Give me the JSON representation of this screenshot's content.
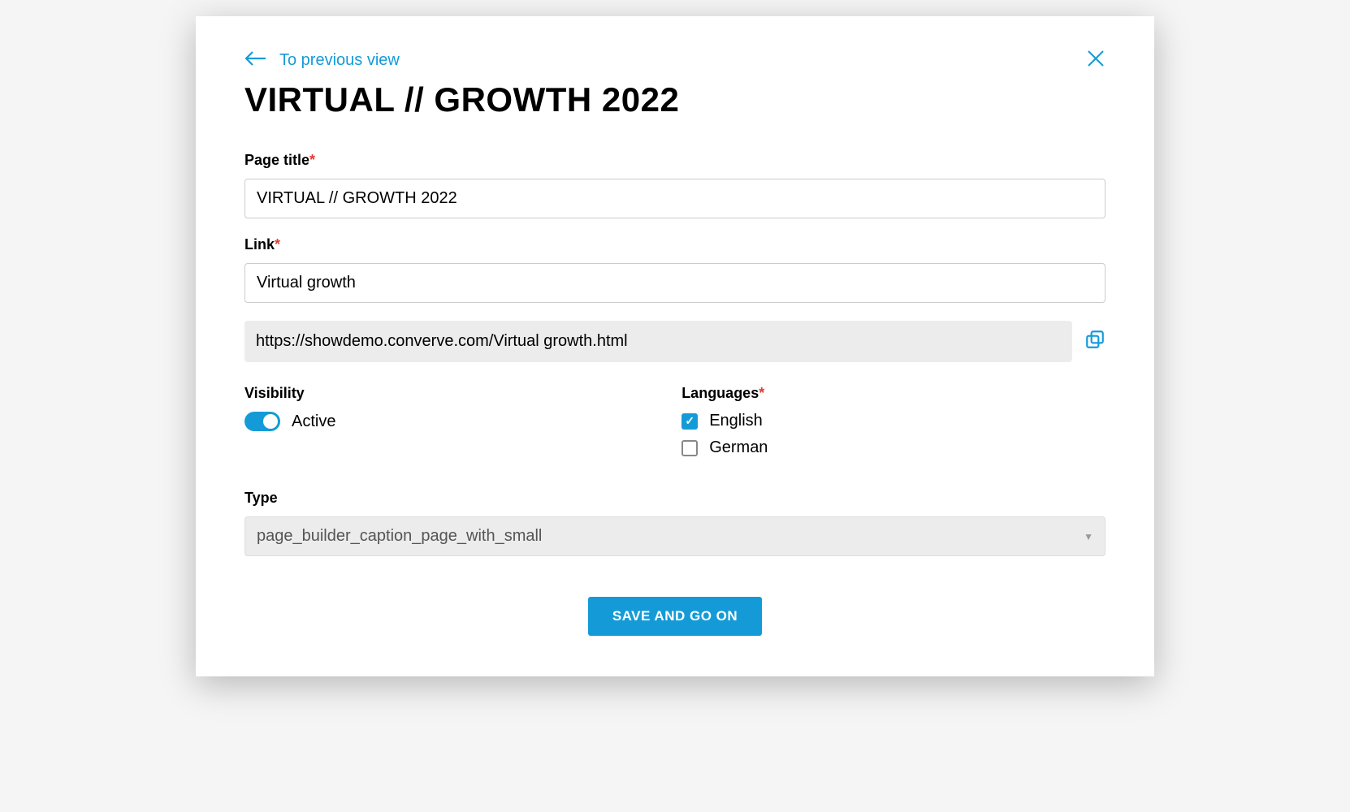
{
  "nav": {
    "back_label": "To previous view"
  },
  "heading": "VIRTUAL // GROWTH 2022",
  "fields": {
    "page_title": {
      "label": "Page title",
      "value": "VIRTUAL // GROWTH 2022",
      "required": true
    },
    "link": {
      "label": "Link",
      "value": "Virtual growth",
      "required": true
    },
    "url": {
      "value": "https://showdemo.converve.com/Virtual growth.html"
    },
    "visibility": {
      "label": "Visibility",
      "state_label": "Active",
      "active": true
    },
    "languages": {
      "label": "Languages",
      "required": true,
      "options": [
        {
          "label": "English",
          "checked": true
        },
        {
          "label": "German",
          "checked": false
        }
      ]
    },
    "type": {
      "label": "Type",
      "selected": "page_builder_caption_page_with_small"
    }
  },
  "actions": {
    "submit": "SAVE AND GO ON"
  }
}
